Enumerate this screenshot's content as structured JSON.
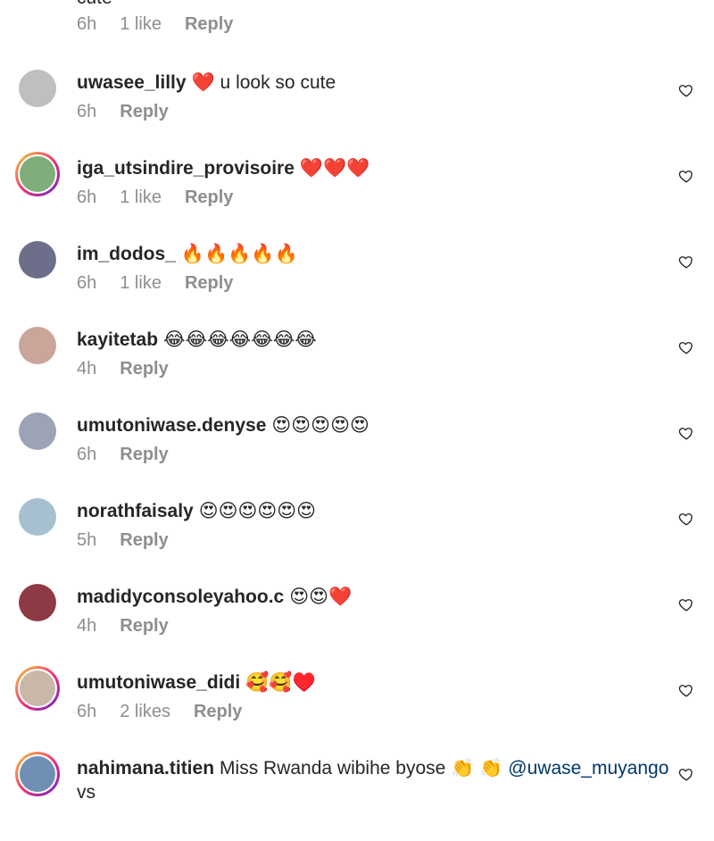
{
  "top": {
    "cut_text": "cute",
    "time": "6h",
    "likes": "1 like",
    "reply": "Reply"
  },
  "comments": [
    {
      "user": "uwasee_lilly",
      "text": "❤️ u look so cute",
      "time": "6h",
      "likes": "",
      "reply": "Reply",
      "avatar_color": "#bfbfbf",
      "ring": false
    },
    {
      "user": "iga_utsindire_provisoire",
      "text": "❤️❤️❤️",
      "time": "6h",
      "likes": "1 like",
      "reply": "Reply",
      "avatar_color": "#7fae7a",
      "ring": true
    },
    {
      "user": "im_dodos_",
      "text": "🔥🔥🔥🔥🔥",
      "time": "6h",
      "likes": "1 like",
      "reply": "Reply",
      "avatar_color": "#6d6e8a",
      "ring": false
    },
    {
      "user": "kayitetab",
      "text": "😂😂😂😂😂😂😂",
      "time": "4h",
      "likes": "",
      "reply": "Reply",
      "avatar_color": "#c9a59a",
      "ring": false
    },
    {
      "user": "umutoniwase.denyse",
      "text": "😍😍😍😍😍",
      "time": "6h",
      "likes": "",
      "reply": "Reply",
      "avatar_color": "#9ba3b5",
      "ring": false
    },
    {
      "user": "norathfaisaly",
      "text": "😍😍😍😍😍😍",
      "time": "5h",
      "likes": "",
      "reply": "Reply",
      "avatar_color": "#a7c0cf",
      "ring": false
    },
    {
      "user": "madidyconsoleyahoo.c",
      "text": "😍😍❤️",
      "time": "4h",
      "likes": "",
      "reply": "Reply",
      "avatar_color": "#8e3a44",
      "ring": false
    },
    {
      "user": "umutoniwase_didi",
      "text": "🥰🥰♥️",
      "time": "6h",
      "likes": "2 likes",
      "reply": "Reply",
      "avatar_color": "#c9b8a8",
      "ring": true
    },
    {
      "user": "nahimana.titien",
      "text": "Miss Rwanda wibihe byose 👏 👏",
      "mention": "@uwase_muyango",
      "overflow": "vs",
      "time": "",
      "likes": "",
      "reply": "",
      "avatar_color": "#6f8fb5",
      "ring": true
    }
  ]
}
